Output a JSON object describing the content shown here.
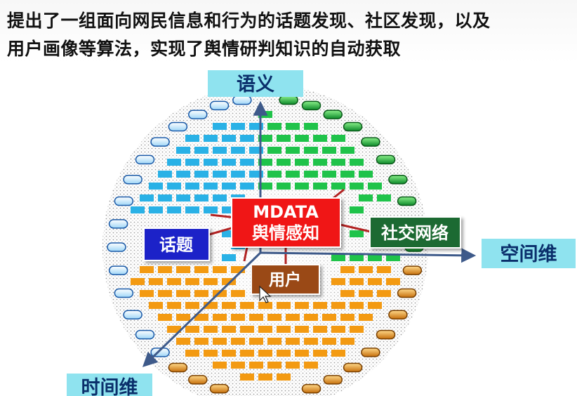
{
  "headline": {
    "line1": "提出了一组面向网民信息和行为的话题发现、社区发现，以及",
    "line2": "用户画像等算法，实现了舆情研判知识的自动获取"
  },
  "diagram": {
    "center": {
      "line1": "MDATA",
      "line2": "舆情感知"
    },
    "nodes": {
      "topic": "话题",
      "social": "社交网络",
      "user": "用户"
    },
    "axes": {
      "semantic": "语义",
      "space": "空间维",
      "time": "时间维"
    }
  },
  "colors": {
    "center_fill": "#f01414",
    "topic_fill": "#1a22c8",
    "social_fill": "#1e6b30",
    "user_fill": "#9a4a12",
    "axis_label_bg": "#8fe3ef",
    "blue_cluster": "#29b1e6",
    "green_cluster": "#1fc34a",
    "orange_cluster": "#f39a12"
  }
}
